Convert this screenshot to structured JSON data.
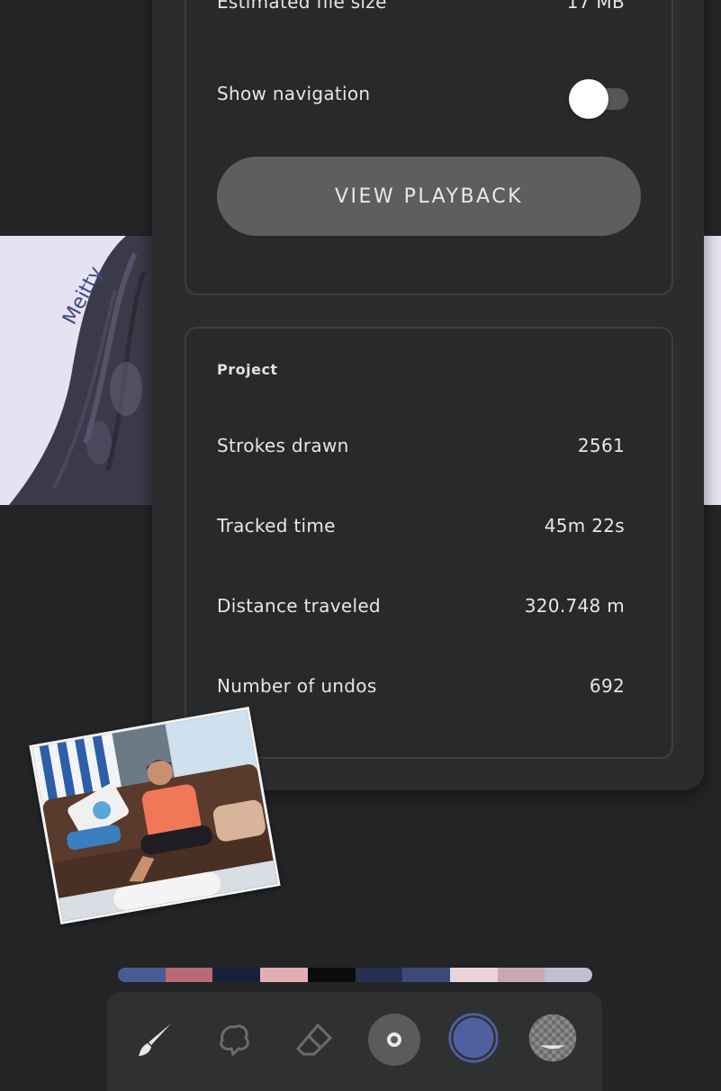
{
  "settings": {
    "file_size_label": "Estimated file size",
    "file_size_value": "17 MB",
    "navigation_label": "Show navigation",
    "navigation_enabled": false,
    "playback_button": "VIEW PLAYBACK"
  },
  "project": {
    "title": "Project",
    "stats": [
      {
        "label": "Strokes drawn",
        "value": "2561"
      },
      {
        "label": "Tracked time",
        "value": "45m 22s"
      },
      {
        "label": "Distance traveled",
        "value": "320.748 m"
      },
      {
        "label": "Number of undos",
        "value": "692"
      }
    ]
  },
  "canvas": {
    "signature": "Meitty"
  },
  "palette": {
    "colors": [
      "#4a5a93",
      "#b66a74",
      "#1a1f3a",
      "#e3aeb3",
      "#0b0b0d",
      "#28304f",
      "#3c4a78",
      "#e9d3d9",
      "#c9a8b1",
      "#c3bdd3"
    ]
  },
  "toolbar": {
    "tools": [
      "brush-icon",
      "smudge-icon",
      "eraser-icon",
      "brush-size-icon",
      "color-icon",
      "layer-icon"
    ],
    "current_color": "#4f5fa0"
  }
}
